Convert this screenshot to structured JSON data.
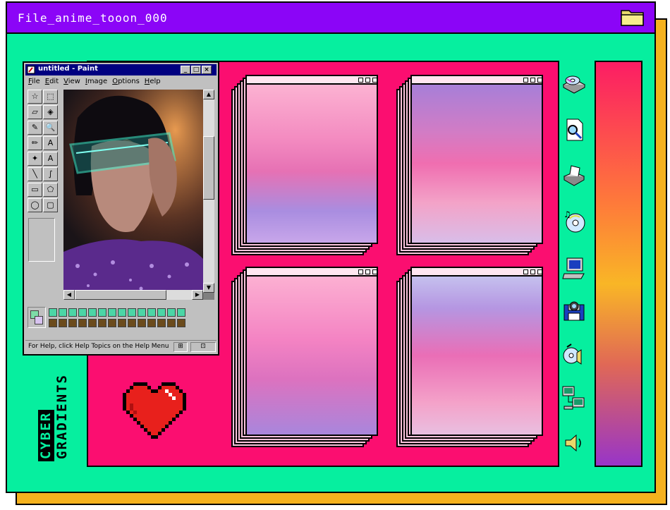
{
  "window": {
    "title": "File_anime_tooon_000",
    "title_bar_color": "#8b05f7",
    "background_color": "#06ef9f",
    "shadow_color": "#f5b21e",
    "icon": "folder-icon"
  },
  "paint": {
    "title": "untitled - Paint",
    "menu": [
      "File",
      "Edit",
      "View",
      "Image",
      "Options",
      "Help"
    ],
    "controls": [
      "_",
      "□",
      "×"
    ],
    "status": "For Help, click Help Topics on the Help Menu.",
    "image_subject": "photo-of-person-with-neon-visor",
    "tools": [
      "free-select-icon",
      "select-icon",
      "eraser-icon",
      "fill-icon",
      "picker-icon",
      "magnifier-icon",
      "pencil-icon",
      "brush-icon",
      "airbrush-icon",
      "text-icon",
      "line-icon",
      "curve-icon",
      "rectangle-icon",
      "polygon-icon",
      "ellipse-icon",
      "rounded-rect-icon"
    ],
    "palette_top": [
      "#4bd6a6",
      "#4bd6a6",
      "#4bd6a6",
      "#4bd6a6",
      "#4bd6a6",
      "#4bd6a6",
      "#4bd6a6",
      "#4bd6a6",
      "#4bd6a6",
      "#4bd6a6",
      "#4bd6a6",
      "#4bd6a6",
      "#4bd6a6",
      "#4bd6a6"
    ],
    "palette_bottom": [
      "#6b4b1c",
      "#6b4b1c",
      "#6b4b1c",
      "#6b4b1c",
      "#6b4b1c",
      "#6b4b1c",
      "#6b4b1c",
      "#6b4b1c",
      "#6b4b1c",
      "#6b4b1c",
      "#6b4b1c",
      "#6b4b1c",
      "#6b4b1c",
      "#6b4b1c"
    ]
  },
  "gradient_windows": [
    {
      "gradient": "linear-gradient(to bottom, #fcb2d2 0%, #f38ac0 35%, #e671b4 55%, #a98de0 80%, #c8a6ea 100%)"
    },
    {
      "gradient": "linear-gradient(to bottom, #a77fd8 0%, #d27cc5 30%, #f06eb0 50%, #f3a3c8 75%, #d9bde8 100%)"
    },
    {
      "gradient": "linear-gradient(to bottom, #fcb0d2 0%, #f483c3 40%, #dc72bf 65%, #a986dc 100%)"
    },
    {
      "gradient": "linear-gradient(to bottom, #c5c0ee 0%, #b596e2 20%, #ea6eb6 50%, #f4a2c9 80%, #e9bfe0 100%)"
    }
  ],
  "side_icons": [
    "cd-drive-icon",
    "document-search-icon",
    "printer-icon",
    "music-cd-icon",
    "computer-icon",
    "camera-floppy-icon",
    "speaker-cd-icon",
    "network-icon",
    "volume-icon"
  ],
  "accent_colors": {
    "pink_panel": "#fb0e70",
    "heart": "#e8201c"
  },
  "branding": {
    "line1": "CYBER",
    "line2": "GRADIENTS"
  }
}
